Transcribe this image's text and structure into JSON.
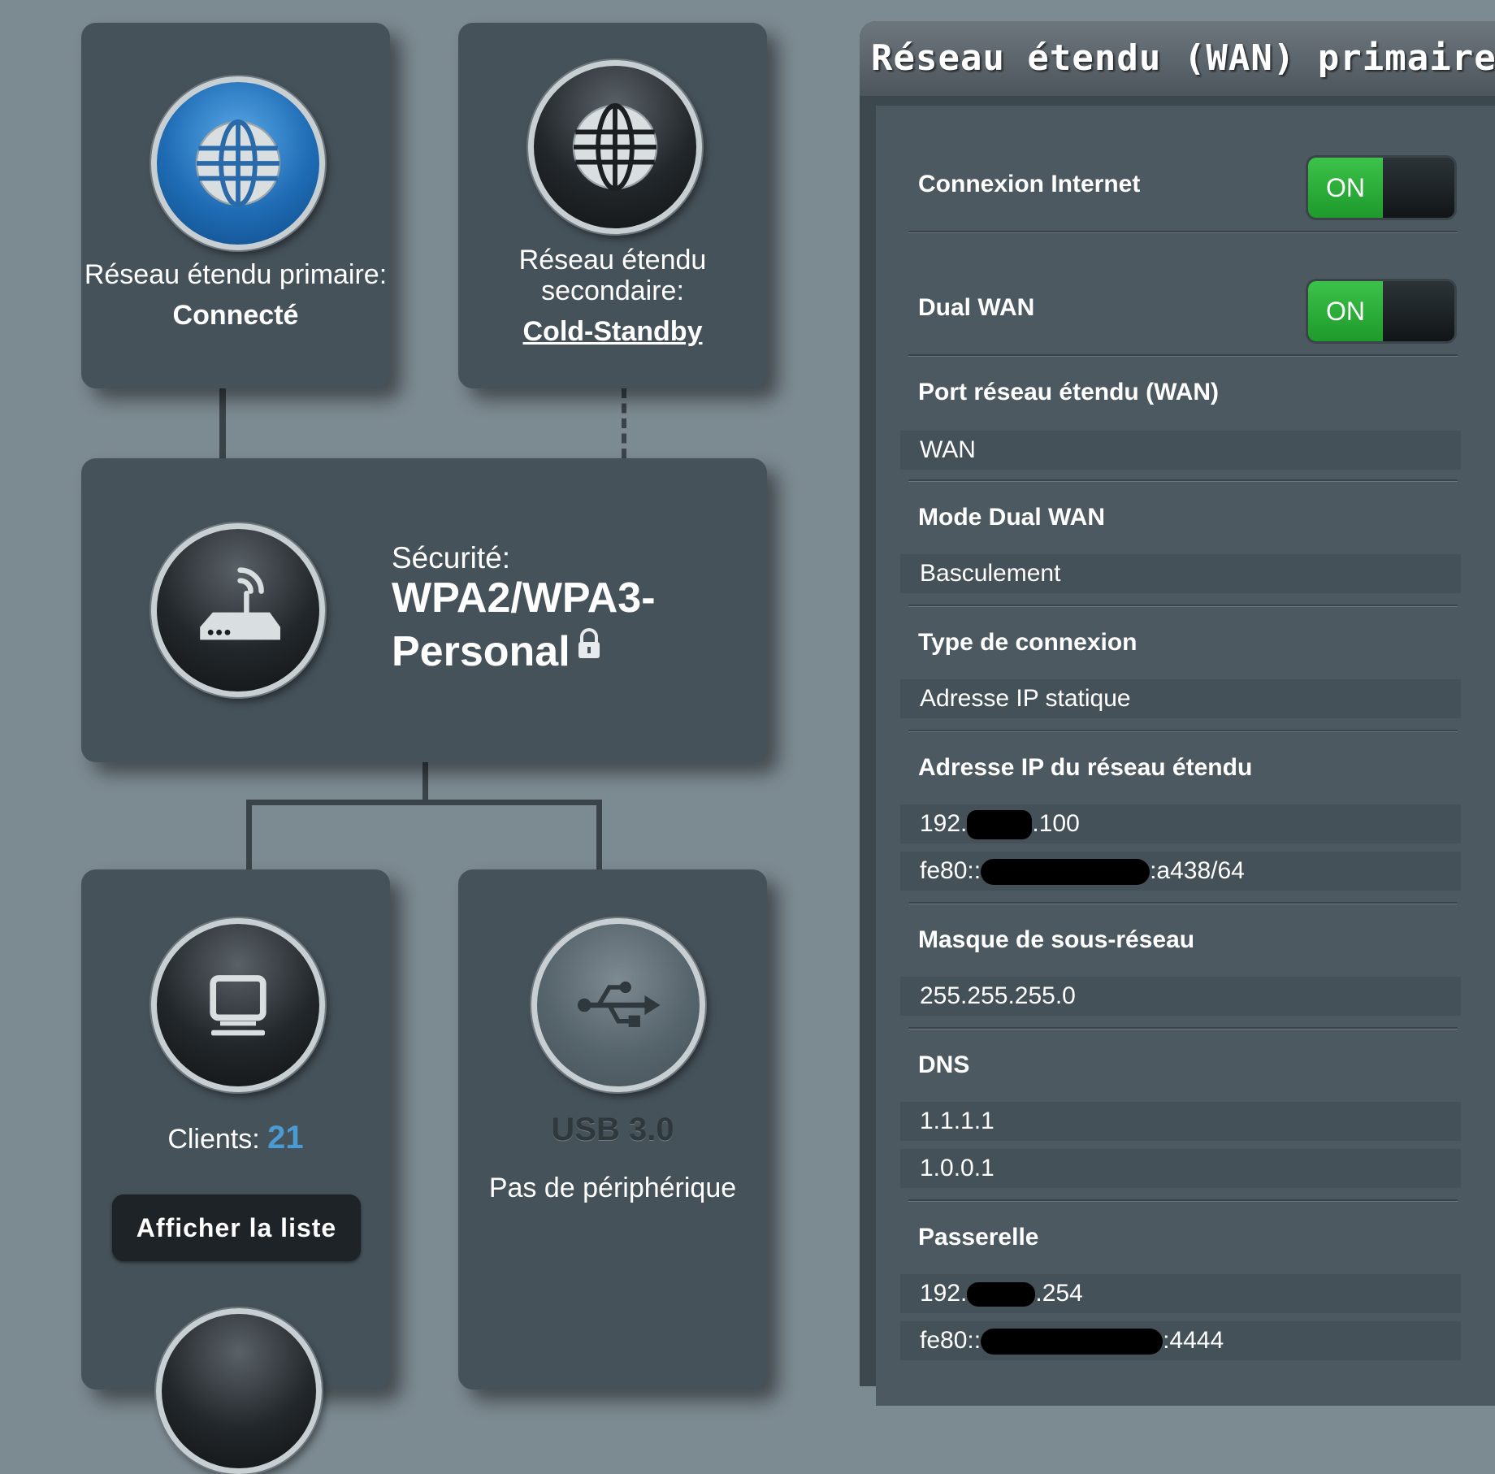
{
  "network_map": {
    "primary_wan": {
      "label": "Réseau étendu primaire:",
      "status": "Connecté"
    },
    "secondary_wan": {
      "label_line1": "Réseau étendu",
      "label_line2": "secondaire:",
      "status": "Cold-Standby"
    },
    "router": {
      "security_label": "Sécurité:",
      "security_value_line1": "WPA2/WPA3-",
      "security_value_line2": "Personal"
    },
    "clients": {
      "label": "Clients:",
      "count": "21",
      "button": "Afficher la liste"
    },
    "usb": {
      "title": "USB 3.0",
      "status": "Pas de périphérique"
    }
  },
  "wan_panel": {
    "title": "Réseau étendu (WAN) primaire",
    "internet_connection": {
      "label": "Connexion Internet",
      "toggle": "ON"
    },
    "dual_wan": {
      "label": "Dual WAN",
      "toggle": "ON"
    },
    "wan_port": {
      "label": "Port réseau étendu (WAN)",
      "value": "WAN"
    },
    "dual_wan_mode": {
      "label": "Mode Dual WAN",
      "value": "Basculement"
    },
    "connection_type": {
      "label": "Type de connexion",
      "value": "Adresse IP statique"
    },
    "wan_ip": {
      "label": "Adresse IP du réseau étendu",
      "ipv4_prefix": "192.",
      "ipv4_suffix": ".100",
      "ipv6_prefix": "fe80::",
      "ipv6_suffix": ":a438/64"
    },
    "subnet_mask": {
      "label": "Masque de sous-réseau",
      "value": "255.255.255.0"
    },
    "dns": {
      "label": "DNS",
      "primary": "1.1.1.1",
      "secondary": "1.0.0.1"
    },
    "gateway": {
      "label": "Passerelle",
      "ipv4_prefix": "192.",
      "ipv4_suffix": ".254",
      "ipv6_prefix": "fe80::",
      "ipv6_suffix": ":4444"
    }
  },
  "colors": {
    "accent_blue": "#4a9ad4",
    "toggle_on": "#2eb03c",
    "background": "#7c8a91"
  }
}
